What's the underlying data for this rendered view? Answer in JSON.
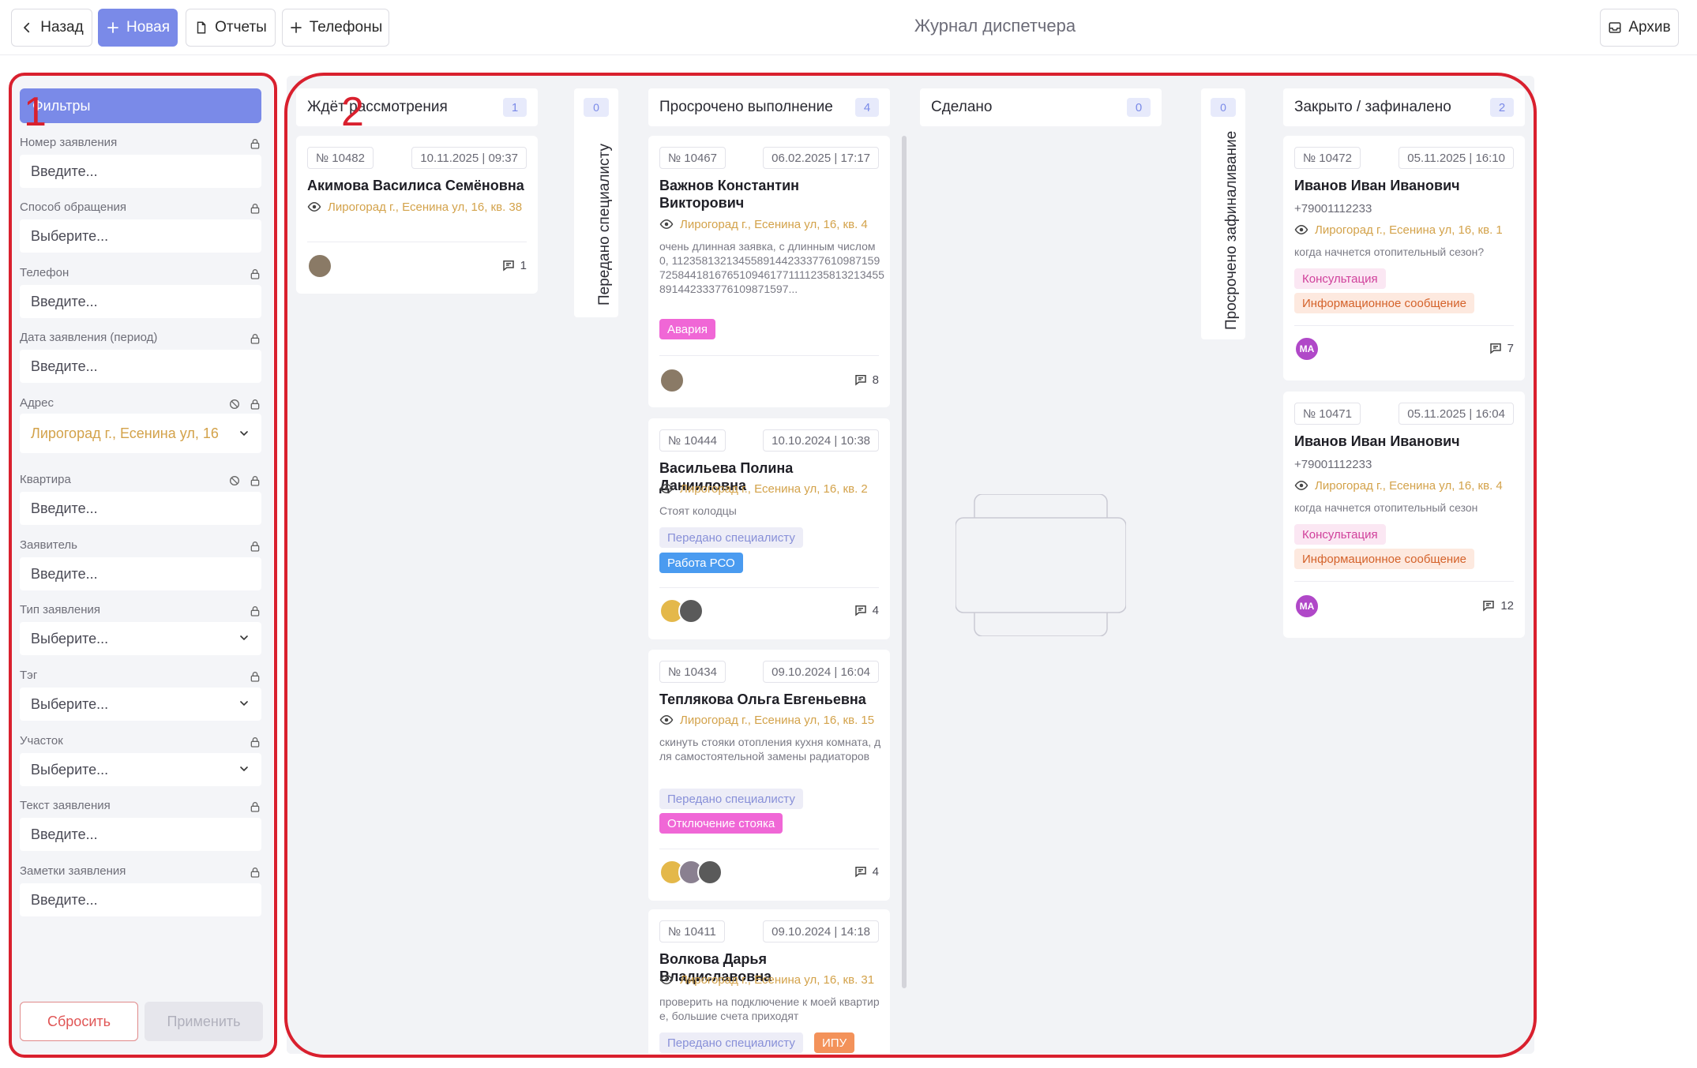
{
  "toolbar": {
    "back_label": "Назад",
    "new_label": "Новая",
    "reports_label": "Отчеты",
    "phones_label": "Телефоны",
    "archive_label": "Архив"
  },
  "page_title": "Журнал диспетчера",
  "filters": {
    "header": "Фильтры",
    "fields": [
      {
        "label": "Номер заявления",
        "value": "Введите..."
      },
      {
        "label": "Способ обращения",
        "value": "Выберите..."
      },
      {
        "label": "Телефон",
        "value": "Введите..."
      },
      {
        "label": "Дата заявления (период)",
        "value": "Введите..."
      },
      {
        "label": "Адрес",
        "value": "Лирогорад г., Есенина ул, 16"
      },
      {
        "label": "Квартира",
        "value": "Введите..."
      },
      {
        "label": "Заявитель",
        "value": "Введите..."
      },
      {
        "label": "Тип заявления",
        "value": "Выберите..."
      },
      {
        "label": "Тэг",
        "value": "Выберите..."
      },
      {
        "label": "Участок",
        "value": "Выберите..."
      },
      {
        "label": "Текст заявления",
        "value": "Введите..."
      },
      {
        "label": "Заметки заявления",
        "value": "Введите..."
      }
    ],
    "reset_label": "Сбросить",
    "apply_label": "Применить"
  },
  "columns": {
    "waiting": {
      "title": "Ждёт рассмотрения",
      "count": "1",
      "cards": [
        {
          "num": "№ 10482",
          "date": "10.11.2025 | 09:37",
          "name": "Акимова Василиса Семёновна",
          "address": "Лирогорад г., Есенина ул, 16, кв. 38",
          "comments": "1"
        }
      ]
    },
    "to_specialist": {
      "title": "Передано специалисту",
      "count": "0"
    },
    "overdue": {
      "title": "Просрочено выполнение",
      "count": "4",
      "cards": [
        {
          "num": "№ 10467",
          "date": "06.02.2025 | 17:17",
          "name": "Важнов Константин Викторович",
          "address": "Лирогорад г., Есенина ул, 16, кв. 4",
          "desc": "очень длинная заявка, с длинным числом 0, 11235813213455891442333776109871597258441816765109461771111235813213455891442333776109871597...",
          "tags": [
            "Авария"
          ],
          "comments": "8"
        },
        {
          "num": "№ 10444",
          "date": "10.10.2024 | 10:38",
          "name": "Васильева Полина Данииловна",
          "address": "Лирогорад г., Есенина ул, 16, кв. 2",
          "desc": "Стоят колодцы",
          "tags": [
            "Передано специалисту",
            "Работа РСО"
          ],
          "comments": "4"
        },
        {
          "num": "№ 10434",
          "date": "09.10.2024 | 16:04",
          "name": "Теплякова Ольга Евгеньевна",
          "address": "Лирогорад г., Есенина ул, 16, кв. 15",
          "desc": "скинуть стояки отопления кухня комната, для самостоятельной замены радиаторов",
          "tags": [
            "Передано специалисту",
            "Отключение стояка"
          ],
          "comments": "4"
        },
        {
          "num": "№ 10411",
          "date": "09.10.2024 | 14:18",
          "name": "Волкова Дарья Владиславовна",
          "address": "Лирогорад г., Есенина ул, 16, кв. 31",
          "desc": "проверить на подключение к моей квартире, большие счета приходят",
          "tags": [
            "Передано специалисту",
            "ИПУ"
          ]
        }
      ]
    },
    "done": {
      "title": "Сделано",
      "count": "0"
    },
    "overdue_final": {
      "title": "Просрочено зафиналивание",
      "count": "0"
    },
    "closed": {
      "title": "Закрыто / зафиналено",
      "count": "2",
      "cards": [
        {
          "num": "№ 10472",
          "date": "05.11.2025 | 16:10",
          "name": "Иванов Иван Иванович",
          "phone": "+79001112233",
          "address": "Лирогорад г., Есенина ул, 16, кв. 1",
          "desc": "когда начнется отопительный сезон?",
          "tags": [
            "Консультация",
            "Информационное сообщение"
          ],
          "avatar": "МА",
          "comments": "7"
        },
        {
          "num": "№ 10471",
          "date": "05.11.2025 | 16:04",
          "name": "Иванов Иван Иванович",
          "phone": "+79001112233",
          "address": "Лирогорад г., Есенина ул, 16, кв. 4",
          "desc": "когда начнется отопительный сезон",
          "tags": [
            "Консультация",
            "Информационное сообщение"
          ],
          "avatar": "МА",
          "comments": "12"
        }
      ]
    }
  },
  "annotations": {
    "one": "1",
    "two": "2"
  }
}
